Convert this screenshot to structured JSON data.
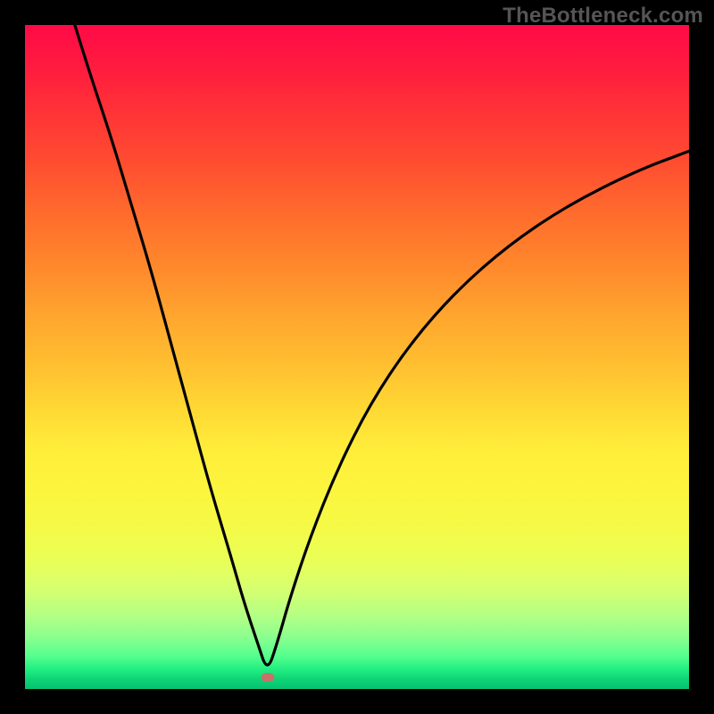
{
  "watermark": "TheBottleneck.com",
  "chart_data": {
    "type": "line",
    "title": "",
    "xlabel": "",
    "ylabel": "",
    "xlim": [
      0,
      100
    ],
    "ylim": [
      0,
      100
    ],
    "vertex_x": 36.5,
    "marker": {
      "x_pct": 36.5,
      "y_pct": 98.2
    },
    "series": [
      {
        "name": "curve",
        "x": [
          7.5,
          10,
          13,
          16,
          19,
          22,
          25,
          28,
          31,
          33,
          35,
          36.5,
          38,
          40,
          43,
          47,
          52,
          58,
          65,
          73,
          82,
          92,
          100
        ],
        "y_from_top": [
          0,
          8,
          17,
          27,
          37,
          48,
          59,
          70,
          80,
          87,
          93,
          97.5,
          93,
          86,
          77,
          67,
          57,
          48,
          40,
          33,
          27,
          22,
          19
        ]
      }
    ],
    "gradient_stops": [
      {
        "pos": 0,
        "color": "#ff0a47"
      },
      {
        "pos": 50,
        "color": "#ffc231"
      },
      {
        "pos": 75,
        "color": "#f4fa47"
      },
      {
        "pos": 100,
        "color": "#06c170"
      }
    ]
  }
}
